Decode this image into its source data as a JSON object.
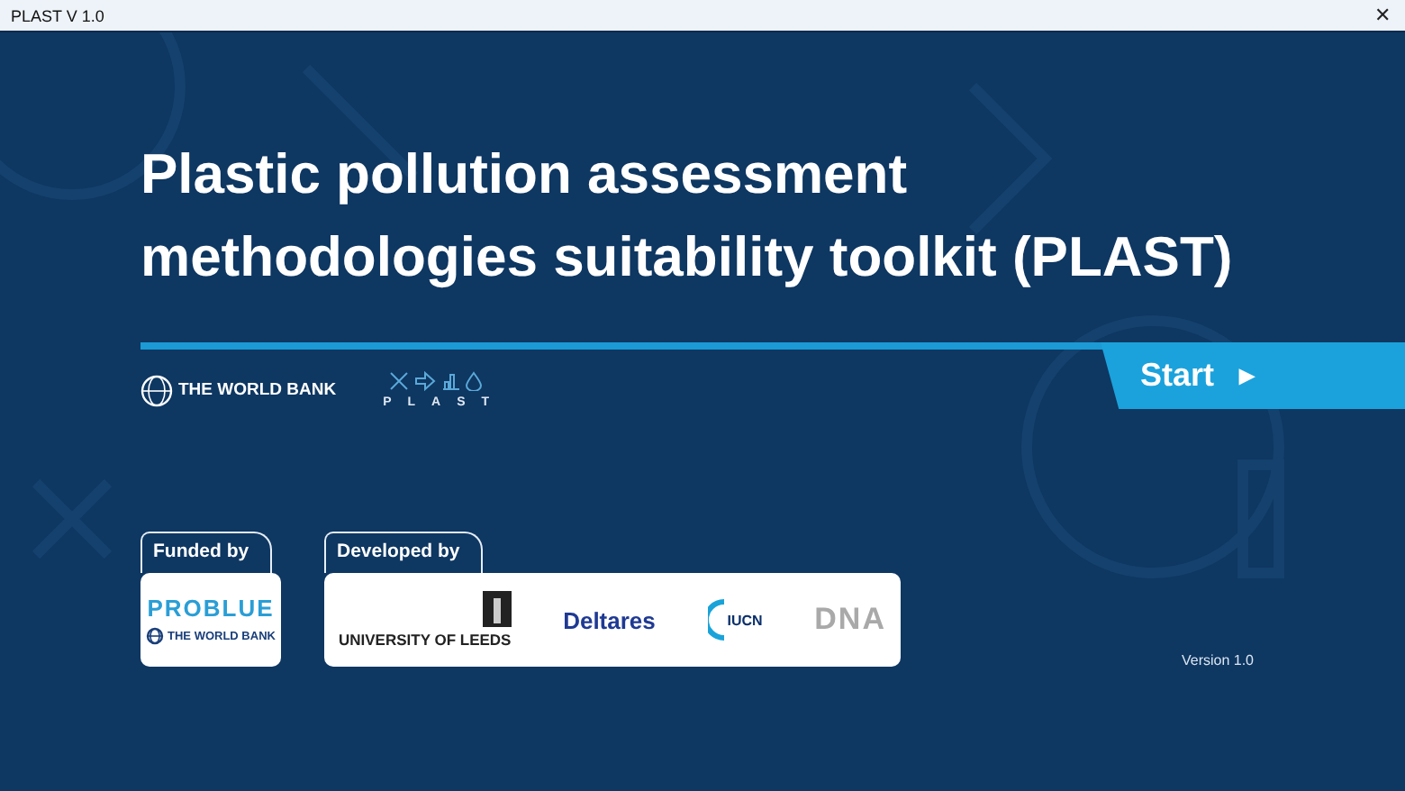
{
  "window": {
    "title": "PLAST V 1.0",
    "close": "✕"
  },
  "title": "Plastic pollution assessment methodologies suitability toolkit (PLAST)",
  "start_button": {
    "label": "Start",
    "arrow": "▶"
  },
  "logos": {
    "world_bank": "THE WORLD BANK",
    "plast": "PLAST"
  },
  "funded": {
    "label": "Funded by",
    "problue": "PROBLUE",
    "world_bank": "THE WORLD BANK"
  },
  "developed": {
    "label": "Developed by",
    "partners": [
      {
        "kind": "leeds",
        "name": "UNIVERSITY OF LEEDS"
      },
      {
        "kind": "deltares",
        "name": "Deltares"
      },
      {
        "kind": "iucn",
        "name": "IUCN"
      },
      {
        "kind": "dna",
        "name": "DNA"
      }
    ]
  },
  "version": "Version 1.0"
}
